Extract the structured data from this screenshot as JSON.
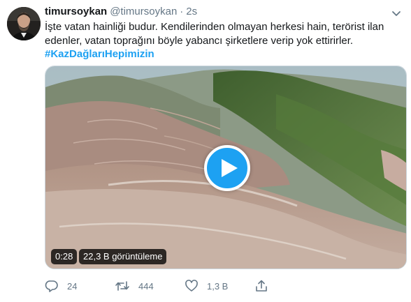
{
  "author": {
    "display_name": "timursoykan",
    "handle": "@timursoykan",
    "separator": "·",
    "time": "2s"
  },
  "tweet": {
    "text_lines": [
      "İşte vatan hainliği budur.  Kendilerinden olmayan herkesi hain, terörist ilan",
      "edenler, vatan toprağını böyle yabancı şirketlere verip yok ettirirler."
    ],
    "hashtag": "#KazDağlarıHepimizin"
  },
  "video": {
    "duration": "0:28",
    "views": "22,3 B görüntüleme"
  },
  "actions": {
    "replies": "24",
    "retweets": "444",
    "likes": "1,3 B"
  },
  "colors": {
    "accent": "#1da1f2",
    "secondary_text": "#657786",
    "primary_text": "#14171a"
  },
  "icons": [
    "chevron-down-icon",
    "play-icon",
    "reply-icon",
    "retweet-icon",
    "like-icon",
    "share-icon"
  ]
}
